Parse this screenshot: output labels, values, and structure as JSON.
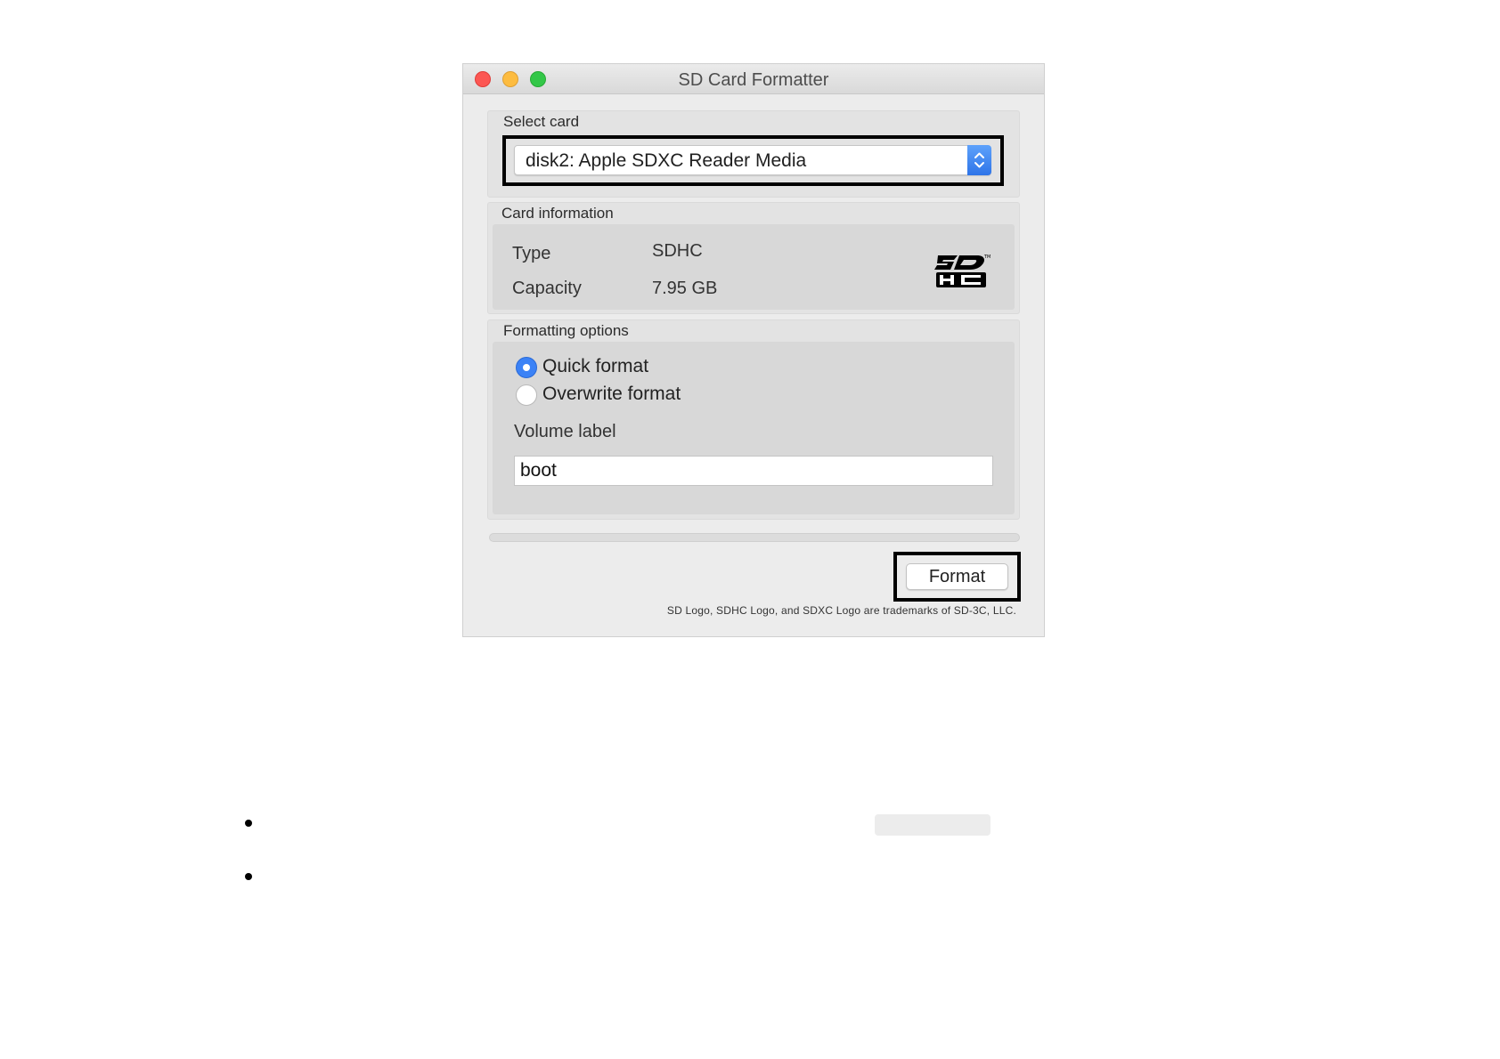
{
  "window": {
    "title": "SD Card Formatter"
  },
  "select_card": {
    "label": "Select card",
    "selected": "disk2: Apple SDXC Reader Media"
  },
  "card_information": {
    "label": "Card information",
    "type_label": "Type",
    "type_value": "SDHC",
    "capacity_label": "Capacity",
    "capacity_value": "7.95 GB",
    "logo_icon": "sdhc-logo-icon"
  },
  "formatting_options": {
    "label": "Formatting options",
    "options": [
      {
        "label": "Quick format",
        "selected": true
      },
      {
        "label": "Overwrite format",
        "selected": false
      }
    ],
    "volume_label_title": "Volume label",
    "volume_label_value": "boot"
  },
  "progress": 0,
  "actions": {
    "format_label": "Format"
  },
  "footer": {
    "note": "SD Logo, SDHC Logo, and SDXC Logo are trademarks of SD-3C, LLC."
  },
  "colors": {
    "accent": "#3b82f6",
    "close": "#fc5753",
    "minimize": "#fdbc40",
    "maximize": "#33c748"
  }
}
